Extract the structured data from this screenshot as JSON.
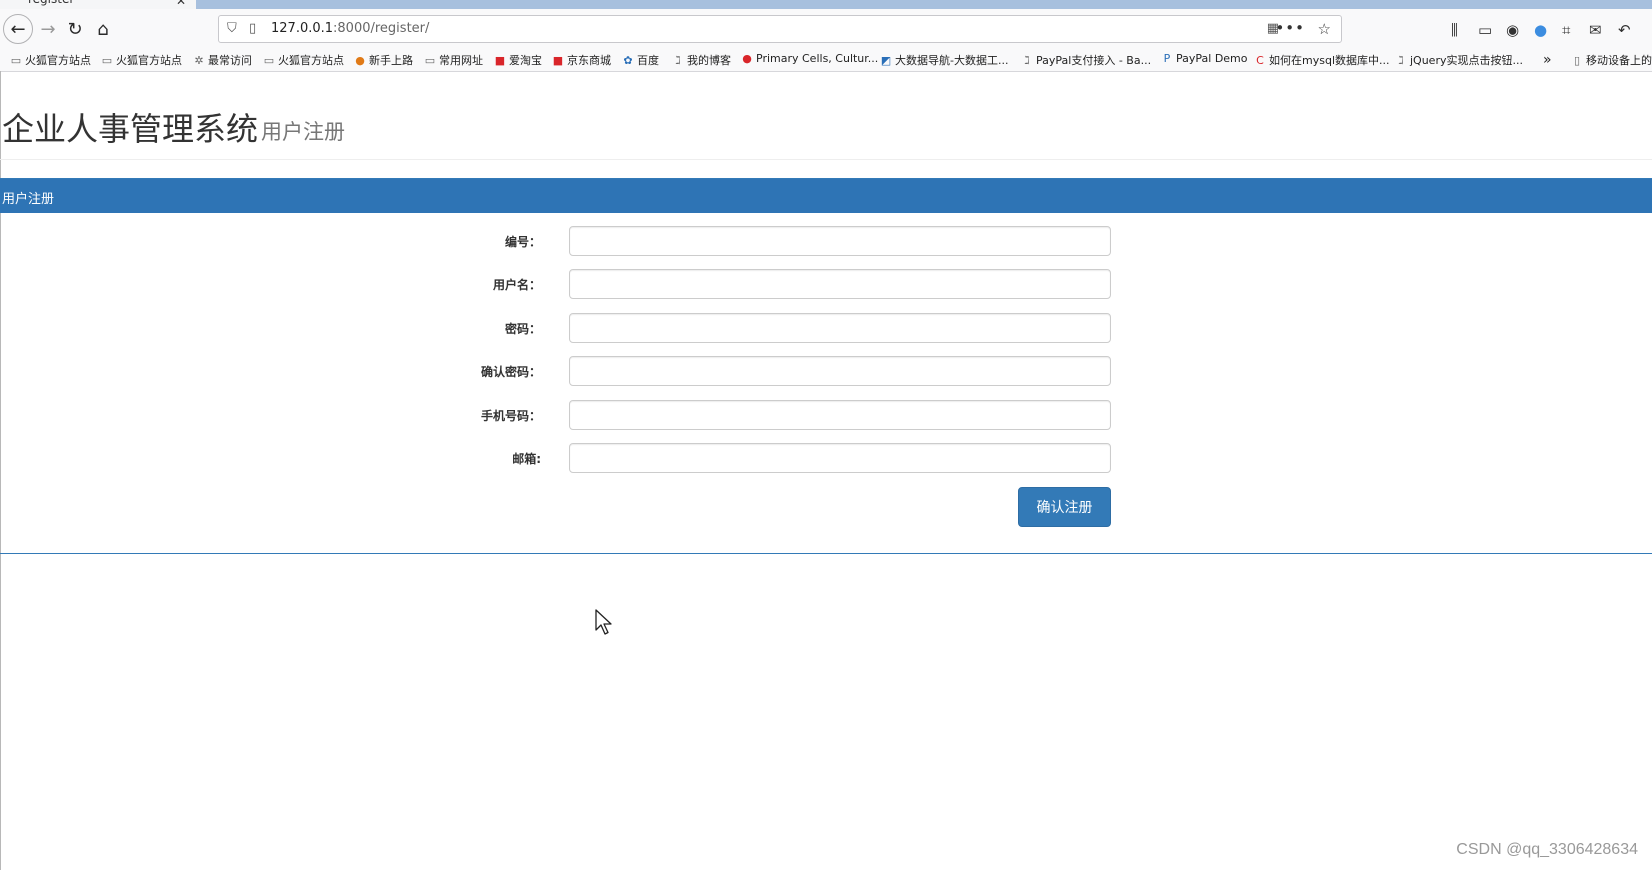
{
  "browser": {
    "tab_title": "register",
    "tab_close": "✕",
    "url_host": "127.0.0.1",
    "url_rest": ":8000/register/",
    "bookmarks": [
      {
        "label": "火狐官方站点",
        "icon": "folder-icon"
      },
      {
        "label": "火狐官方站点",
        "icon": "folder-icon"
      },
      {
        "label": "最常访问",
        "icon": "gear-icon"
      },
      {
        "label": "火狐官方站点",
        "icon": "folder-icon"
      },
      {
        "label": "新手上路",
        "icon": "firefox-icon"
      },
      {
        "label": "常用网址",
        "icon": "folder-icon"
      },
      {
        "label": "爱淘宝",
        "icon": "taobao-icon"
      },
      {
        "label": "京东商城",
        "icon": "jd-icon"
      },
      {
        "label": "百度",
        "icon": "baidu-icon"
      },
      {
        "label": "我的博客",
        "icon": "blog-icon"
      },
      {
        "label": "Primary Cells, Cultur...",
        "icon": "site-icon"
      },
      {
        "label": "大数据导航-大数据工...",
        "icon": "site-icon"
      },
      {
        "label": "PayPal支付接入 - Ba...",
        "icon": "blog-icon"
      },
      {
        "label": "PayPal Demo",
        "icon": "paypal-icon"
      },
      {
        "label": "如何在mysql数据库中...",
        "icon": "csdn-icon"
      },
      {
        "label": "jQuery实现点击按钮...",
        "icon": "blog-icon"
      },
      {
        "label": "移动设备上的书签",
        "icon": "mobile-icon"
      }
    ],
    "overflow_label": "»"
  },
  "page": {
    "title": "企业人事管理系统",
    "subtitle": "用户注册",
    "panel_heading": "用户注册",
    "form": {
      "fields": [
        {
          "label": "编号：",
          "value": ""
        },
        {
          "label": "用户名：",
          "value": ""
        },
        {
          "label": "密码：",
          "value": ""
        },
        {
          "label": "确认密码：",
          "value": ""
        },
        {
          "label": "手机号码：",
          "value": ""
        },
        {
          "label": "邮箱:",
          "value": ""
        }
      ],
      "submit_label": "确认注册"
    }
  },
  "watermark": "CSDN @qq_3306428634",
  "colors": {
    "panel_heading_bg": "#2e74b5",
    "button_bg": "#337ab7"
  }
}
